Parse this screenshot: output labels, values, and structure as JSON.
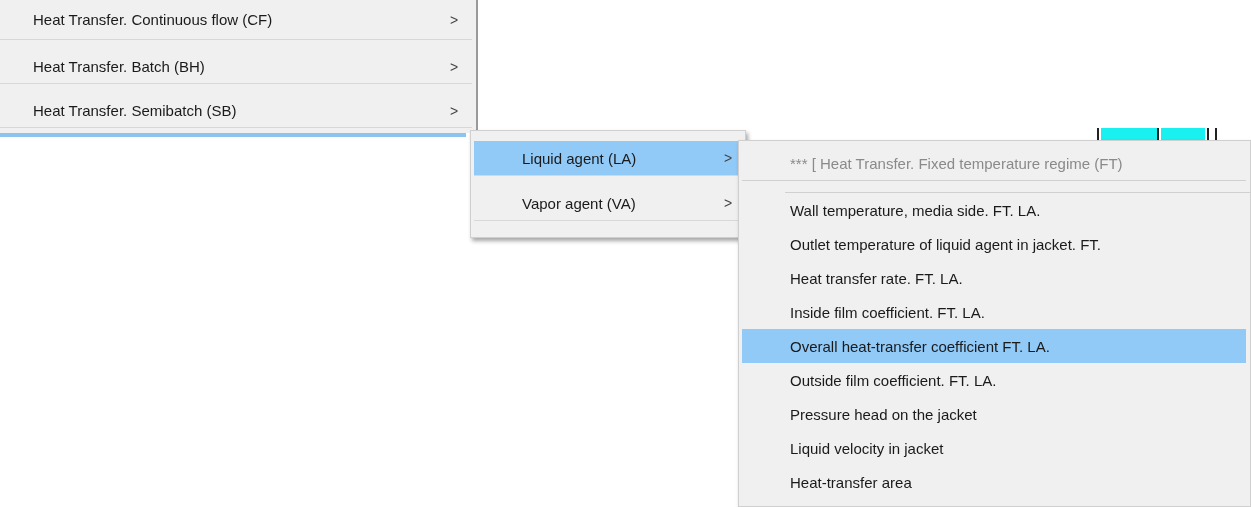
{
  "menus": [
    {
      "items": [
        {
          "kind": "submenu",
          "label": "Heat Transfer. Continuous flow (CF)",
          "arrow": ">",
          "selected": false
        },
        {
          "kind": "submenu",
          "label": "Heat Transfer. Batch (BH)",
          "arrow": ">",
          "selected": false
        },
        {
          "kind": "submenu",
          "label": "Heat Transfer. Semibatch (SB)",
          "arrow": ">",
          "selected": false
        }
      ]
    },
    {
      "items": [
        {
          "kind": "submenu",
          "label": "Liquid agent (LA)",
          "arrow": ">",
          "selected": true
        },
        {
          "kind": "submenu",
          "label": "Vapor agent (VA)",
          "arrow": ">",
          "selected": false
        }
      ]
    },
    {
      "items": [
        {
          "kind": "header",
          "label": "*** [ Heat Transfer. Fixed temperature regime (FT)",
          "selected": false
        },
        {
          "kind": "item",
          "label": "Wall temperature, media side. FT. LA.",
          "selected": false
        },
        {
          "kind": "item",
          "label": "Outlet temperature of liquid agent in jacket. FT.",
          "selected": false
        },
        {
          "kind": "item",
          "label": "Heat transfer rate. FT. LA.",
          "selected": false
        },
        {
          "kind": "item",
          "label": "Inside film coefficient. FT. LA.",
          "selected": false
        },
        {
          "kind": "item",
          "label": "Overall heat-transfer coefficient FT. LA.",
          "selected": true
        },
        {
          "kind": "item",
          "label": "Outside film coefficient. FT. LA.",
          "selected": false
        },
        {
          "kind": "item",
          "label": "Pressure head on the jacket",
          "selected": false
        },
        {
          "kind": "item",
          "label": "Liquid velocity in jacket",
          "selected": false
        },
        {
          "kind": "item",
          "label": "Heat-transfer area",
          "selected": false
        }
      ]
    }
  ]
}
